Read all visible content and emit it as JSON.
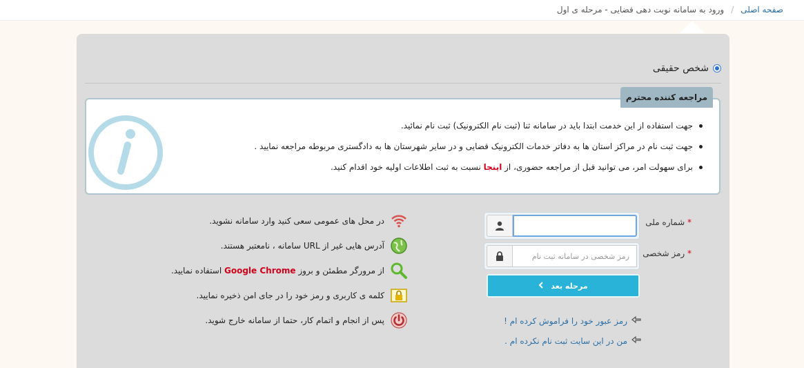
{
  "breadcrumb": {
    "home": "صفحه اصلی",
    "separator": "/",
    "current": "ورود به سامانه نوبت دهی قضایی - مرحله ی اول"
  },
  "person_type": {
    "label": "شخص حقیقی",
    "selected": true
  },
  "notice": {
    "title": "مراجعه کننده محترم",
    "items": [
      "جهت استفاده از این خدمت ابتدا باید در سامانه ثنا (ثبت نام الکترونیک) ثبت نام نمائید.",
      "جهت ثبت نام در مراکز استان ها به دفاتر خدمات الکترونیک قضایی و در سایر شهرستان ها به دادگستری مربوطه مراجعه نمایید ."
    ],
    "item3_before": "برای سهولت امر، می توانید قبل از مراجعه حضوری، از ",
    "item3_link": "اینجا",
    "item3_after": " نسبت به ثبت اطلاعات اولیه خود اقدام کنید."
  },
  "form": {
    "national_id_label": "شماره ملی",
    "password_label": "رمز شخصی",
    "required_mark": "*",
    "national_id_value": "",
    "password_placeholder": "رمز شخصی در سامانه ثبت نام",
    "next_button": "مرحله بعد",
    "forgot_password": "رمز عبور خود را فراموش کرده ام !",
    "not_registered": "من در این سایت ثبت نام نکرده ام ."
  },
  "tips": {
    "t1": "در محل های عمومی سعی کنید وارد سامانه نشوید.",
    "t2": "آدرس هایی غیر از URL سامانه ، نامعتبر هستند.",
    "t3_before": "از مرورگر مطمئن و بروز ",
    "t3_brand": "Google Chrome",
    "t3_after": " استفاده نمایید.",
    "t4": "کلمه ی کاربری و رمز خود را در جای امن ذخیره نمایید.",
    "t5": "پس از انجام و اتمام کار، حتما از سامانه خارج شوید."
  },
  "colors": {
    "accent": "#29b3d9",
    "link": "#2a6fa6",
    "required": "#d0021b",
    "panel": "#dcdcdc"
  }
}
